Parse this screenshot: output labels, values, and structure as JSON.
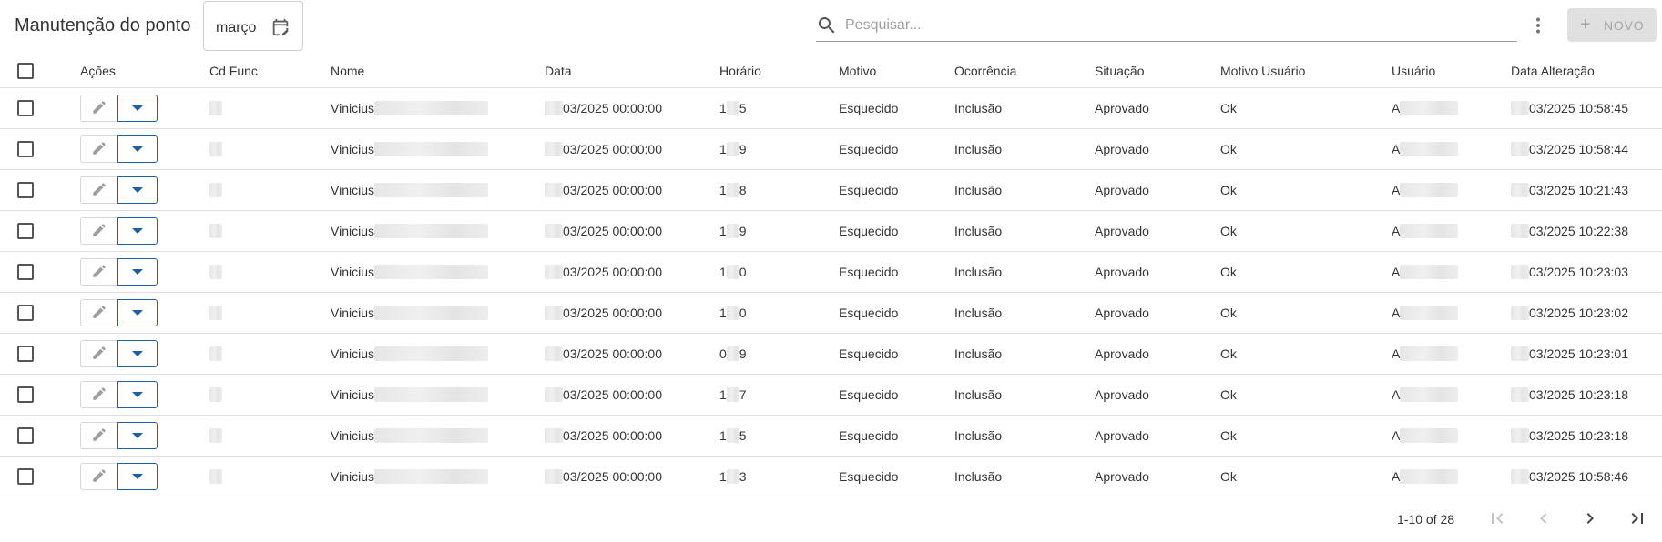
{
  "header": {
    "title": "Manutenção do ponto",
    "month_value": "março",
    "search_placeholder": "Pesquisar...",
    "new_button_label": "NOVO",
    "icons": {
      "calendar": "calendar-edit-icon",
      "search": "search-icon",
      "more": "more-vert-icon",
      "add": "plus-icon"
    }
  },
  "table": {
    "columns": [
      "Ações",
      "Cd Func",
      "Nome",
      "Data",
      "Horário",
      "Motivo",
      "Ocorrência",
      "Situação",
      "Motivo Usuário",
      "Usuário",
      "Data Alteração"
    ],
    "rows": [
      {
        "nome": "Vinicius",
        "data": "03/2025 00:00:00",
        "horario_a": "1",
        "horario_b": "5",
        "motivo": "Esquecido",
        "ocorrencia": "Inclusão",
        "situacao": "Aprovado",
        "motivo_usuario": "Ok",
        "usuario": "A",
        "data_alteracao": "03/2025 10:58:45"
      },
      {
        "nome": "Vinicius",
        "data": "03/2025 00:00:00",
        "horario_a": "1",
        "horario_b": "9",
        "motivo": "Esquecido",
        "ocorrencia": "Inclusão",
        "situacao": "Aprovado",
        "motivo_usuario": "Ok",
        "usuario": "A",
        "data_alteracao": "03/2025 10:58:44"
      },
      {
        "nome": "Vinicius",
        "data": "03/2025 00:00:00",
        "horario_a": "1",
        "horario_b": "8",
        "motivo": "Esquecido",
        "ocorrencia": "Inclusão",
        "situacao": "Aprovado",
        "motivo_usuario": "Ok",
        "usuario": "A",
        "data_alteracao": "03/2025 10:21:43"
      },
      {
        "nome": "Vinicius",
        "data": "03/2025 00:00:00",
        "horario_a": "1",
        "horario_b": "9",
        "motivo": "Esquecido",
        "ocorrencia": "Inclusão",
        "situacao": "Aprovado",
        "motivo_usuario": "Ok",
        "usuario": "A",
        "data_alteracao": "03/2025 10:22:38"
      },
      {
        "nome": "Vinicius",
        "data": "03/2025 00:00:00",
        "horario_a": "1",
        "horario_b": "0",
        "motivo": "Esquecido",
        "ocorrencia": "Inclusão",
        "situacao": "Aprovado",
        "motivo_usuario": "Ok",
        "usuario": "A",
        "data_alteracao": "03/2025 10:23:03"
      },
      {
        "nome": "Vinicius",
        "data": "03/2025 00:00:00",
        "horario_a": "1",
        "horario_b": "0",
        "motivo": "Esquecido",
        "ocorrencia": "Inclusão",
        "situacao": "Aprovado",
        "motivo_usuario": "Ok",
        "usuario": "A",
        "data_alteracao": "03/2025 10:23:02"
      },
      {
        "nome": "Vinicius",
        "data": "03/2025 00:00:00",
        "horario_a": "0",
        "horario_b": "9",
        "motivo": "Esquecido",
        "ocorrencia": "Inclusão",
        "situacao": "Aprovado",
        "motivo_usuario": "Ok",
        "usuario": "A",
        "data_alteracao": "03/2025 10:23:01"
      },
      {
        "nome": "Vinicius",
        "data": "03/2025 00:00:00",
        "horario_a": "1",
        "horario_b": "7",
        "motivo": "Esquecido",
        "ocorrencia": "Inclusão",
        "situacao": "Aprovado",
        "motivo_usuario": "Ok",
        "usuario": "A",
        "data_alteracao": "03/2025 10:23:18"
      },
      {
        "nome": "Vinicius",
        "data": "03/2025 00:00:00",
        "horario_a": "1",
        "horario_b": "5",
        "motivo": "Esquecido",
        "ocorrencia": "Inclusão",
        "situacao": "Aprovado",
        "motivo_usuario": "Ok",
        "usuario": "A",
        "data_alteracao": "03/2025 10:23:18"
      },
      {
        "nome": "Vinicius",
        "data": "03/2025 00:00:00",
        "horario_a": "1",
        "horario_b": "3",
        "motivo": "Esquecido",
        "ocorrencia": "Inclusão",
        "situacao": "Aprovado",
        "motivo_usuario": "Ok",
        "usuario": "A",
        "data_alteracao": "03/2025 10:58:46"
      }
    ]
  },
  "pagination": {
    "info": "1-10 of 28",
    "icons": [
      "first-page-icon",
      "prev-page-icon",
      "next-page-icon",
      "last-page-icon"
    ]
  },
  "colors": {
    "accent": "#1f5fa8",
    "border": "#e0e0e0",
    "disabled_bg": "#e0e0e0"
  }
}
